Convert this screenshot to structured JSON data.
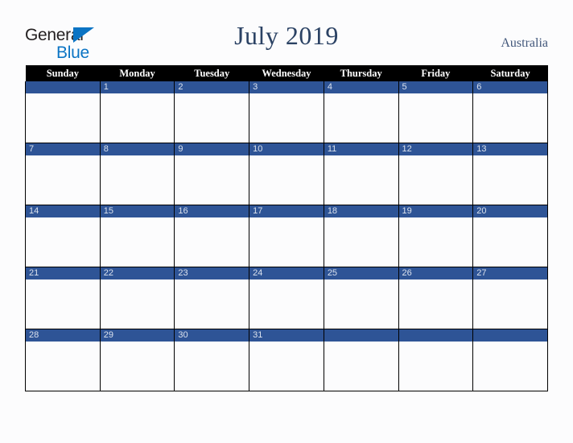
{
  "brand": {
    "name_part1": "General",
    "name_part2": "Blue",
    "triangle_color": "#0b74c4",
    "text_color": "#231f20"
  },
  "header": {
    "title": "July 2019",
    "region": "Australia",
    "title_color": "#2b4264"
  },
  "calendar": {
    "weekday_headers": [
      "Sunday",
      "Monday",
      "Tuesday",
      "Wednesday",
      "Thursday",
      "Friday",
      "Saturday"
    ],
    "header_bg": "#000000",
    "header_text_color": "#ffffff",
    "day_band_color": "#2e5496",
    "day_number_color": "#dbe2ee",
    "cell_bg": "#fcfcfd",
    "weeks": [
      [
        {
          "day": ""
        },
        {
          "day": "1"
        },
        {
          "day": "2"
        },
        {
          "day": "3"
        },
        {
          "day": "4"
        },
        {
          "day": "5"
        },
        {
          "day": "6"
        }
      ],
      [
        {
          "day": "7"
        },
        {
          "day": "8"
        },
        {
          "day": "9"
        },
        {
          "day": "10"
        },
        {
          "day": "11"
        },
        {
          "day": "12"
        },
        {
          "day": "13"
        }
      ],
      [
        {
          "day": "14"
        },
        {
          "day": "15"
        },
        {
          "day": "16"
        },
        {
          "day": "17"
        },
        {
          "day": "18"
        },
        {
          "day": "19"
        },
        {
          "day": "20"
        }
      ],
      [
        {
          "day": "21"
        },
        {
          "day": "22"
        },
        {
          "day": "23"
        },
        {
          "day": "24"
        },
        {
          "day": "25"
        },
        {
          "day": "26"
        },
        {
          "day": "27"
        }
      ],
      [
        {
          "day": "28"
        },
        {
          "day": "29"
        },
        {
          "day": "30"
        },
        {
          "day": "31"
        },
        {
          "day": ""
        },
        {
          "day": ""
        },
        {
          "day": ""
        }
      ]
    ]
  }
}
